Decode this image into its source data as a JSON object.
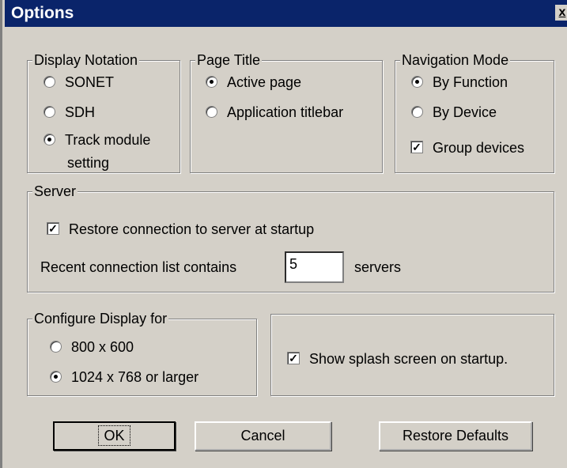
{
  "window": {
    "title": "Options",
    "close_label": "x"
  },
  "display_notation": {
    "legend": "Display Notation",
    "options": [
      {
        "label": "SONET",
        "checked": false
      },
      {
        "label": "SDH",
        "checked": false
      },
      {
        "label": "Track module",
        "label2": "setting",
        "checked": true
      }
    ]
  },
  "page_title": {
    "legend": "Page Title",
    "options": [
      {
        "label": "Active page",
        "checked": true
      },
      {
        "label": "Application titlebar",
        "checked": false
      }
    ]
  },
  "navigation_mode": {
    "legend": "Navigation Mode",
    "options": [
      {
        "label": "By Function",
        "checked": true
      },
      {
        "label": "By Device",
        "checked": false
      }
    ],
    "group_devices": {
      "label": "Group devices",
      "checked": true
    }
  },
  "server": {
    "legend": "Server",
    "restore_connection": {
      "label": "Restore connection to server at startup",
      "checked": true
    },
    "recent_label": "Recent connection list contains",
    "recent_value": "5",
    "recent_suffix": "servers"
  },
  "configure_display": {
    "legend": "Configure Display for",
    "options": [
      {
        "label": "800 x 600",
        "checked": false
      },
      {
        "label": "1024 x 768 or larger",
        "checked": true
      }
    ]
  },
  "splash": {
    "label": "Show splash screen on startup.",
    "checked": true
  },
  "buttons": {
    "ok": "OK",
    "cancel": "Cancel",
    "restore_defaults": "Restore Defaults"
  },
  "check_mark": "✓"
}
